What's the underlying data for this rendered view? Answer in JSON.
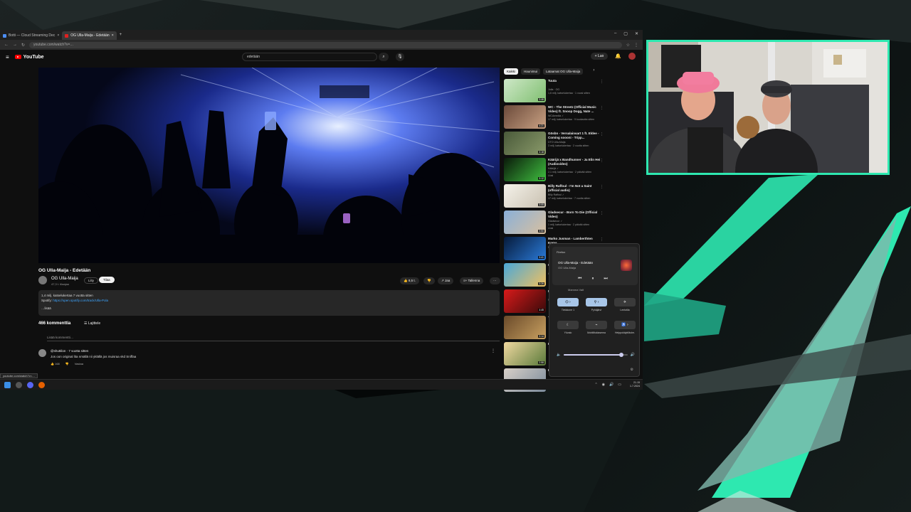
{
  "browser": {
    "tabs": [
      {
        "title": "Botti — Cloud Streaming Dec",
        "active": false
      },
      {
        "title": "OG Ulla-Maija - Edetään",
        "active": true
      }
    ],
    "url": "youtube.com/watch?v=…"
  },
  "youtube": {
    "logo_text": "YouTube",
    "search_value": "edetään",
    "create_label": "Luo",
    "video": {
      "title": "OG Ulla-Maija - Edetään",
      "channel": "OG Ulla-Maija",
      "subscribers": "47,3 t. tilaajaa",
      "join_label": "Liity",
      "subscribe_label": "Tilaa",
      "likes": "8,5 t.",
      "share_label": "Jaa",
      "save_label": "Tallenna",
      "description_line1": "1,4 milj. katselukertaa 7 vuotta sitten",
      "description_link_prefix": "Spotify:",
      "description_link": "https://open.spotify.com/track/Ulla-Pola",
      "description_more": "…lisää"
    },
    "comments": {
      "count_label": "466 kommenttia",
      "sort_label": "Lajittele",
      "add_placeholder": "Lisää kommentti…",
      "first": {
        "author": "@shuttilon",
        "time": "7 vuotta sitten",
        "text": "Jos oon original lita nmällä nii yklällä jos muisraa vkd Sniffaa",
        "likes": "168",
        "reply_label": "Vastaa"
      }
    },
    "status_url": "youtube.com/watch?v=…"
  },
  "recommendations": {
    "chips": [
      "Kaikki",
      "Haunimui",
      "Lataamat OG Ulla-Maija"
    ],
    "items": [
      {
        "title": "Tuuta",
        "meta": "Julla · OG\n1,6 milj. katselukertaa · 1 vuosi sitten",
        "duration": "3:46"
      },
      {
        "title": "WC - The Streetz (Official Music Video) ft. Snoop Dogg, Nate ...",
        "meta": "WCAmedia ✓\n17 milj. katselukertaa · 9 kuukautta sitten",
        "duration": "4:21"
      },
      {
        "title": "Gösbn - Versalainsart 1 ft. Eldee - Coming soooni - Tripp...",
        "meta": "DTO Ulla-Maija\n3 milj. katselukertaa · 2 vuotta sitten",
        "duration": "3:18"
      },
      {
        "title": "Käärijä x Bandhunner - Ja Elin Hei (Audiovideo)",
        "meta": "Käärijä ✓\n2,1 milj. katselukertaa · 2 päivää sitten\nUusi",
        "duration": "3:12"
      },
      {
        "title": "Billy Raffoul - I'm Not a Saint (official audio)",
        "meta": "Billy Raffoul ✓\n17 milj. katselukertaa · 7 vuotta sitten",
        "duration": "3:05"
      },
      {
        "title": "Gladsecur - Born To Die (Official Video)",
        "meta": "Gladsecur ✓\n1 milj. katselukertaa · 2 päivää sitten\nUusi",
        "duration": "3:50"
      },
      {
        "title": "Marko Jusman - Lamberthten Koma",
        "meta": "Marko Jusman\n",
        "duration": "3:41"
      },
      {
        "title": "OG Ulla-Maija - Koira",
        "meta": "OG Ulla-Maija\n",
        "duration": "3:26"
      },
      {
        "title": "Niinku Aina",
        "meta": "Niinku Aina\n",
        "duration": "4:45"
      },
      {
        "title": "Trilogia",
        "meta": "",
        "duration": "3:14"
      },
      {
        "title": "Kesä",
        "meta": "",
        "duration": "2:58"
      },
      {
        "title": "Live",
        "meta": "",
        "duration": ""
      }
    ]
  },
  "media_flyout": {
    "app": "Firefox",
    "track_title": "OG Ulla-Maija - Edetään",
    "track_artist": "OG Ulla-Maija",
    "section_label": "Mamma Vait",
    "tiles": [
      {
        "label": "Tietokone 1",
        "glyph": "⌬ ›",
        "on": true
      },
      {
        "label": "Pyhäjärvi",
        "glyph": "⚲ ›",
        "on": true
      },
      {
        "label": "Lentotila",
        "glyph": "✈",
        "on": false
      },
      {
        "label": "Yövalo",
        "glyph": "☾",
        "on": false
      },
      {
        "label": "Mobiilitukiasema",
        "glyph": "⌁",
        "on": false
      },
      {
        "label": "Helppokäyttötoim.",
        "glyph": "♿ ›",
        "on": false
      }
    ],
    "volume_level": 0.9,
    "colors": {
      "accent": "#a8c6e8"
    }
  },
  "taskbar": {
    "clock_time": "21.15",
    "clock_date": "1.7.2024"
  },
  "colors": {
    "overlay_accent": "#2ee8b0",
    "yt_red": "#ff0000",
    "link_blue": "#3ea6ff"
  }
}
